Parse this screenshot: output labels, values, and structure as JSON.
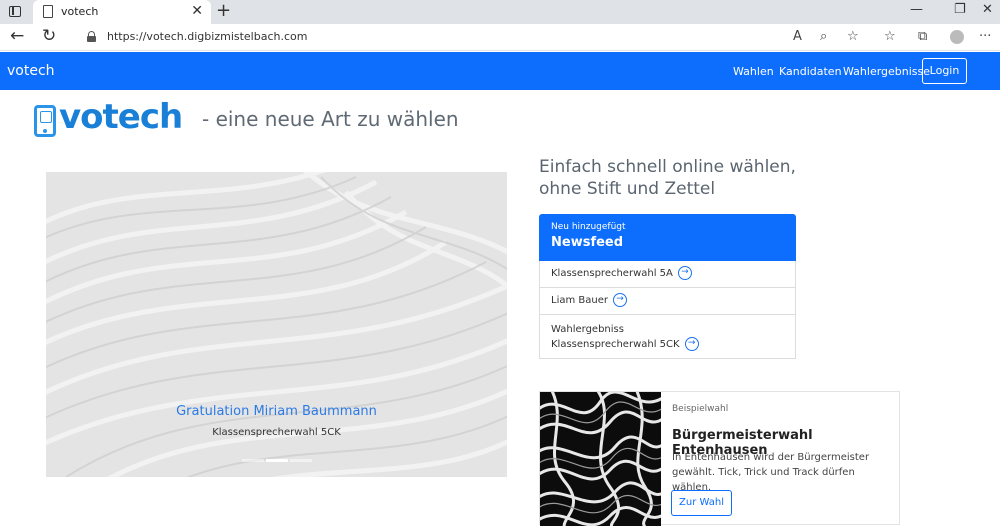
{
  "browser": {
    "tab_title": "votech",
    "url": "https://votech.digbizmistelbach.com",
    "new_tab": "+",
    "tab_close": "✕"
  },
  "navbar": {
    "brand": "votech",
    "links": [
      "Wahlen",
      "Kandidaten",
      "Wahlergebnisse"
    ],
    "login": "Login"
  },
  "hero": {
    "logo_text": "votech",
    "tagline": "- eine neue Art zu wählen"
  },
  "carousel": {
    "caption_title": "Gratulation Miriam Baummann",
    "caption_sub": "Klassensprecherwahl 5CK",
    "slide_count": 3,
    "active_slide": 0
  },
  "headline": {
    "line1": "Einfach schnell online wählen,",
    "line2": "ohne Stift und Zettel"
  },
  "newsfeed": {
    "small": "Neu hinzugefügt",
    "title": "Newsfeed",
    "items": [
      {
        "line1": "Klassensprecherwahl 5A",
        "line2": ""
      },
      {
        "line1": "Liam Bauer",
        "line2": ""
      },
      {
        "line1": "Wahlergebniss",
        "line2": "Klassensprecherwahl 5CK"
      }
    ]
  },
  "card": {
    "label": "Beispielwahl",
    "title": "Bürgermeisterwahl Entenhausen",
    "text": "In Entenhausen wird der Bürgermeister gewählt. Tick, Trick und Track dürfen wählen.",
    "button": "Zur Wahl"
  },
  "colors": {
    "primary": "#0d6efd",
    "logo": "#1a7fd6",
    "caption": "#2c7be5"
  }
}
